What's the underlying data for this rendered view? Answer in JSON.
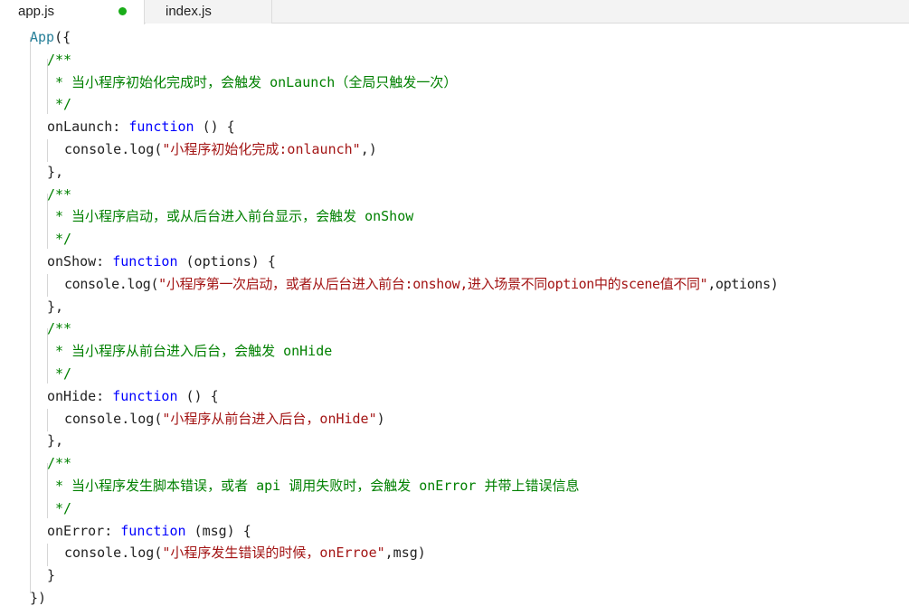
{
  "tabs": [
    {
      "label": "app.js",
      "active": true,
      "modified": true
    },
    {
      "label": "index.js",
      "active": false,
      "modified": false
    }
  ],
  "colors": {
    "modified_dot": "#1aad19",
    "comment": "#008000",
    "keyword": "#0000ff",
    "string": "#a31515",
    "text": "#222222"
  },
  "code": {
    "l1_app": "App",
    "l1_open": "({",
    "l2": "/**",
    "l3": "* 当小程序初始化完成时，会触发 onLaunch（全局只触发一次）",
    "l4": "*/",
    "l5_name": "onLaunch: ",
    "l5_kw": "function",
    "l5_rest": " () {",
    "l6_pre": "console.log(",
    "l6_str": "\"小程序初始化完成:onlaunch\"",
    "l6_post": ",)",
    "l7": "},",
    "l8": "/**",
    "l9": "* 当小程序启动，或从后台进入前台显示，会触发 onShow",
    "l10": "*/",
    "l11_name": "onShow: ",
    "l11_kw": "function",
    "l11_rest": " (options) {",
    "l12_pre": "console.log(",
    "l12_str": "\"小程序第一次启动，或者从后台进入前台:onshow,进入场景不同option中的scene值不同\"",
    "l12_post": ",options)",
    "l13": "},",
    "l14": "/**",
    "l15": "* 当小程序从前台进入后台，会触发 onHide",
    "l16": "*/",
    "l17_name": "onHide: ",
    "l17_kw": "function",
    "l17_rest": " () {",
    "l18_pre": "console.log(",
    "l18_str": "\"小程序从前台进入后台，onHide\"",
    "l18_post": ")",
    "l19": "},",
    "l20": "/**",
    "l21": "* 当小程序发生脚本错误，或者 api 调用失败时，会触发 onError 并带上错误信息",
    "l22": "*/",
    "l23_name": "onError: ",
    "l23_kw": "function",
    "l23_rest": " (msg) {",
    "l24_pre": "console.log(",
    "l24_str": "\"小程序发生错误的时候，onErroe\"",
    "l24_post": ",msg)",
    "l25": "}",
    "l26": "})"
  }
}
